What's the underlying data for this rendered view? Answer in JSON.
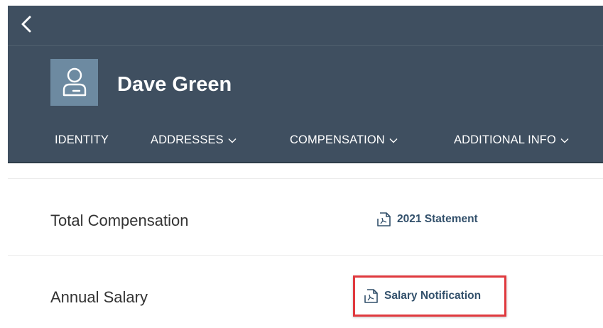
{
  "header": {
    "employee_name": "Dave Green",
    "colors": {
      "background": "#3f4f60",
      "avatar_bg": "#6d8aa1"
    }
  },
  "tabs": [
    {
      "label": "IDENTITY",
      "has_dropdown": false
    },
    {
      "label": "ADDRESSES",
      "has_dropdown": true
    },
    {
      "label": "COMPENSATION",
      "has_dropdown": true
    },
    {
      "label": "ADDITIONAL INFO",
      "has_dropdown": true
    }
  ],
  "rows": [
    {
      "label": "Total Compensation",
      "link": {
        "icon": "pdf-document-icon",
        "label": "2021 Statement"
      }
    },
    {
      "label": "Annual Salary",
      "link": {
        "icon": "pdf-document-icon",
        "label": "Salary Notification",
        "highlighted": true
      }
    }
  ],
  "highlight_color": "#e0393e"
}
